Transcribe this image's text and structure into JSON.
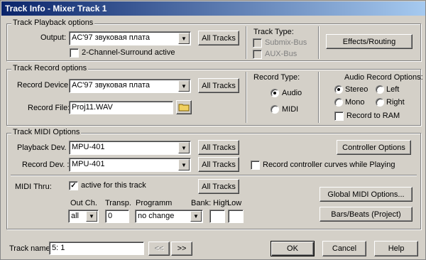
{
  "window": {
    "title": "Track Info - Mixer Track 1"
  },
  "playback": {
    "group_title": "Track Playback options",
    "output_label": "Output:",
    "output_value": "AC'97 звуковая плата",
    "all_tracks": "All Tracks",
    "surround_label": "2-Channel-Surround active",
    "track_type_label": "Track Type:",
    "submix_label": "Submix-Bus",
    "aux_label": "AUX-Bus",
    "effects_button": "Effects/Routing"
  },
  "record": {
    "group_title": "Track Record options",
    "device_label": "Record Device:",
    "device_value": "AC'97 звуковая плата",
    "all_tracks": "All Tracks",
    "file_label": "Record File:",
    "file_value": "Proj11.WAV",
    "record_type_label": "Record Type:",
    "audio_label": "Audio",
    "midi_label": "MIDI",
    "audio_options_label": "Audio Record Options:",
    "stereo_label": "Stereo",
    "left_label": "Left",
    "mono_label": "Mono",
    "right_label": "Right",
    "ram_label": "Record to RAM"
  },
  "midi": {
    "group_title": "Track MIDI Options",
    "playback_label": "Playback Dev. :",
    "playback_value": "MPU-401",
    "record_label": "Record Dev. :",
    "record_value": "MPU-401",
    "all_tracks": "All Tracks",
    "controller_button": "Controller Options",
    "controller_curves_label": "Record controller curves while Playing",
    "thru_label": "MIDI Thru:",
    "thru_active_label": "active for this track",
    "outch_label": "Out Ch.",
    "outch_value": "all",
    "transp_label": "Transp.",
    "transp_value": "0",
    "programm_label": "Programm",
    "programm_value": "no change",
    "bank_label": "Bank: High",
    "low_label": "Low",
    "global_button": "Global MIDI Options...",
    "barsbeats_button": "Bars/Beats (Project)"
  },
  "footer": {
    "trackname_label": "Track name:",
    "trackname_value": "5:  1",
    "prev_label": "<<",
    "next_label": ">>",
    "ok_label": "OK",
    "cancel_label": "Cancel",
    "help_label": "Help"
  }
}
